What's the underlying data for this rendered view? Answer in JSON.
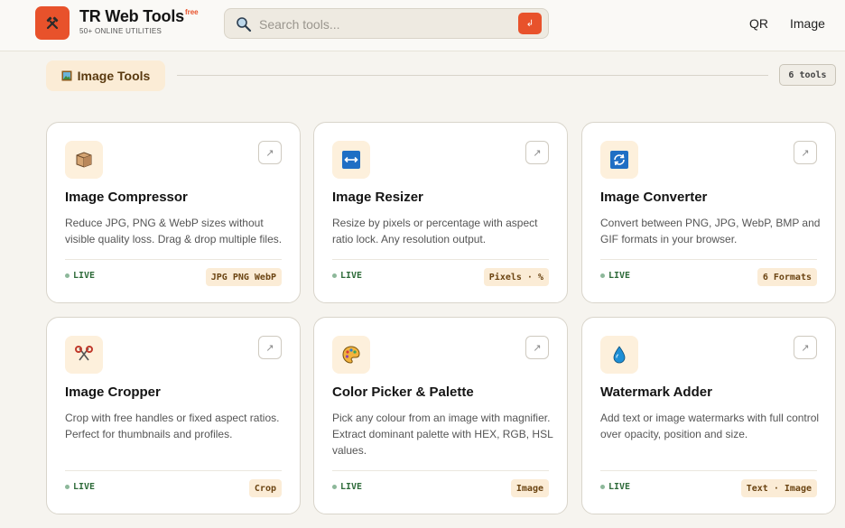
{
  "header": {
    "brand_name": "TR Web Tools",
    "brand_badge": "free",
    "brand_subtitle": "50+ ONLINE UTILITIES",
    "search_placeholder": "Search tools...",
    "search_enter_icon": "↲",
    "nav": [
      {
        "label": "QR"
      },
      {
        "label": "Image"
      }
    ]
  },
  "section": {
    "title": "Image Tools",
    "count": "6 tools"
  },
  "cards": [
    {
      "title": "Image Compressor",
      "desc": "Reduce JPG, PNG & WebP sizes without visible quality loss. Drag & drop multiple files.",
      "status": "LIVE",
      "tag": "JPG PNG WebP",
      "icon": "box-icon"
    },
    {
      "title": "Image Resizer",
      "desc": "Resize by pixels or percentage with aspect ratio lock. Any resolution output.",
      "status": "LIVE",
      "tag": "Pixels · %",
      "icon": "resize-arrows-icon"
    },
    {
      "title": "Image Converter",
      "desc": "Convert between PNG, JPG, WebP, BMP and GIF formats in your browser.",
      "status": "LIVE",
      "tag": "6 Formats",
      "icon": "convert-cycle-icon"
    },
    {
      "title": "Image Cropper",
      "desc": "Crop with free handles or fixed aspect ratios. Perfect for thumbnails and profiles.",
      "status": "LIVE",
      "tag": "Crop",
      "icon": "scissors-icon"
    },
    {
      "title": "Color Picker & Palette",
      "desc": "Pick any colour from an image with magnifier. Extract dominant palette with HEX, RGB, HSL values.",
      "status": "LIVE",
      "tag": "Image",
      "icon": "palette-icon"
    },
    {
      "title": "Watermark Adder",
      "desc": "Add text or image watermarks with full control over opacity, position and size.",
      "status": "LIVE",
      "tag": "Text · Image",
      "icon": "droplet-icon"
    }
  ],
  "colors": {
    "accent": "#e8522b",
    "tag_bg": "#fbecd6",
    "live_text": "#2e6b3a"
  }
}
